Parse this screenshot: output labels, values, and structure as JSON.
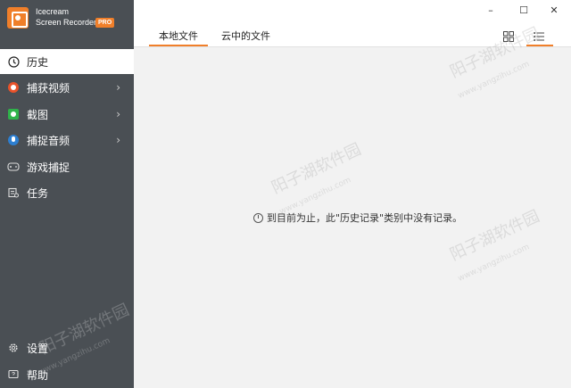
{
  "app": {
    "name_line1": "Icecream",
    "name_line2": "Screen Recorder",
    "badge": "PRO",
    "accent": "#f07f2a"
  },
  "sidebar": {
    "items": [
      {
        "label": "历史",
        "icon": "clock-icon",
        "active": true
      },
      {
        "label": "捕获视频",
        "icon": "record-icon",
        "has_submenu": true
      },
      {
        "label": "截图",
        "icon": "camera-icon",
        "has_submenu": true
      },
      {
        "label": "捕捉音频",
        "icon": "microphone-icon",
        "has_submenu": true
      },
      {
        "label": "游戏捕捉",
        "icon": "gamepad-icon"
      },
      {
        "label": "任务",
        "icon": "tasks-icon"
      }
    ],
    "bottom": [
      {
        "label": "设置",
        "icon": "gear-icon"
      },
      {
        "label": "帮助",
        "icon": "help-icon"
      }
    ],
    "chevron": "›"
  },
  "tabs": [
    {
      "label": "本地文件",
      "active": true
    },
    {
      "label": "云中的文件",
      "active": false
    }
  ],
  "window": {
    "minimize": "–",
    "maximize": "☐",
    "close": "✕"
  },
  "main": {
    "empty_message": "到目前为止，此\"历史记录\"类别中没有记录。"
  },
  "watermark": {
    "text": "阳子湖软件园",
    "url": "www.yangzihu.com"
  }
}
